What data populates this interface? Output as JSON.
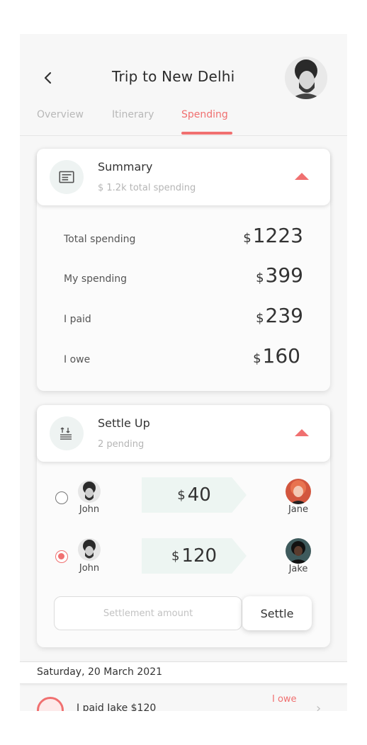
{
  "header": {
    "title": "Trip to New Delhi"
  },
  "tabs": [
    {
      "label": "Overview"
    },
    {
      "label": "Itinerary"
    },
    {
      "label": "Spending"
    }
  ],
  "summary": {
    "title": "Summary",
    "subtitle": "$ 1.2k total spending",
    "rows": [
      {
        "label": "Total spending",
        "currency": "$",
        "value": "1223"
      },
      {
        "label": "My spending",
        "currency": "$",
        "value": "399"
      },
      {
        "label": "I paid",
        "currency": "$",
        "value": "239"
      },
      {
        "label": "I owe",
        "currency": "$",
        "value": "160"
      }
    ]
  },
  "settle_up": {
    "title": "Settle Up",
    "subtitle": "2 pending",
    "items": [
      {
        "from": "John",
        "to": "Jane",
        "currency": "$",
        "amount": "40",
        "selected": false
      },
      {
        "from": "John",
        "to": "Jake",
        "currency": "$",
        "amount": "120",
        "selected": true
      }
    ],
    "input_placeholder": "Settlement amount",
    "button_label": "Settle"
  },
  "date_header": "Saturday, 20 March 2021",
  "transaction": {
    "text": "I paid Jake $120",
    "status": "I owe"
  },
  "colors": {
    "accent": "#f07070",
    "amount_bg": "#edf5f2",
    "icon_bg": "#eef3f2"
  }
}
